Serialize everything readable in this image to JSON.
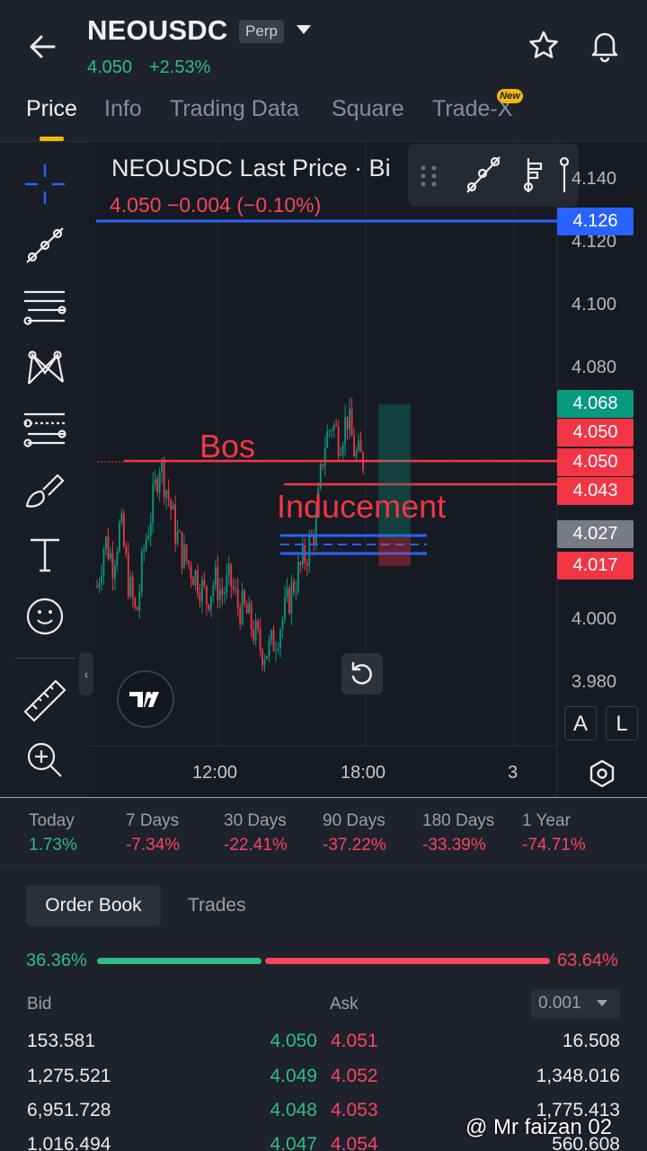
{
  "header": {
    "symbol": "NEOUSDC",
    "contract_type": "Perp",
    "price": "4.050",
    "change": "+2.53%"
  },
  "tabs": [
    {
      "label": "Price",
      "active": true
    },
    {
      "label": "Info"
    },
    {
      "label": "Trading Data"
    },
    {
      "label": "Square"
    },
    {
      "label": "Trade-X",
      "badge": "New"
    }
  ],
  "chart": {
    "title": "NEOUSDC Last Price · Bi",
    "subtitle": "4.050  −0.004 (−0.10%)",
    "y_axis_ticks": [
      "4.140",
      "4.120",
      "4.100",
      "4.080",
      "4.000",
      "3.980"
    ],
    "x_axis_ticks": [
      "12:00",
      "18:00",
      "3"
    ],
    "price_tags": [
      {
        "value": "4.126",
        "color": "#2962ff"
      },
      {
        "value": "4.068",
        "color": "#089981"
      },
      {
        "value": "4.050",
        "color": "#f23645"
      },
      {
        "value": "4.050",
        "color": "#f23645"
      },
      {
        "value": "4.043",
        "color": "#f23645"
      },
      {
        "value": "4.027",
        "color": "#787b86"
      },
      {
        "value": "4.017",
        "color": "#f23645"
      }
    ],
    "annotations": [
      "Bos",
      "Inducement"
    ],
    "scale_buttons": [
      "A",
      "L"
    ]
  },
  "chart_data": {
    "type": "candlestick",
    "title": "NEOUSDC Last Price · Bi",
    "x_ticks": [
      "12:00",
      "18:00",
      "3"
    ],
    "y_ticks": [
      4.14,
      4.12,
      4.1,
      4.08,
      4.0,
      3.98
    ],
    "ylim": [
      3.97,
      4.145
    ],
    "close_path": [
      4.01,
      4.025,
      4.018,
      4.03,
      4.012,
      4.0,
      4.022,
      4.035,
      4.05,
      4.04,
      4.028,
      4.02,
      4.016,
      4.012,
      4.006,
      4.012,
      4.008,
      4.012,
      4.004,
      4.002,
      3.996,
      3.99,
      3.99,
      3.995,
      4.002,
      4.01,
      4.016,
      4.022,
      4.03,
      4.055,
      4.062,
      4.057,
      4.064,
      4.052,
      4.05
    ],
    "horizontal_lines": [
      4.126,
      4.05,
      4.043,
      4.027,
      4.025,
      4.022
    ]
  },
  "performance": [
    {
      "label": "Today",
      "value": "1.73%",
      "positive": true
    },
    {
      "label": "7 Days",
      "value": "-7.34%",
      "positive": false
    },
    {
      "label": "30 Days",
      "value": "-22.41%",
      "positive": false
    },
    {
      "label": "90 Days",
      "value": "-37.22%",
      "positive": false
    },
    {
      "label": "180 Days",
      "value": "-33.39%",
      "positive": false
    },
    {
      "label": "1 Year",
      "value": "-74.71%",
      "positive": false
    }
  ],
  "orderbook": {
    "tab_orderbook": "Order Book",
    "tab_trades": "Trades",
    "bid_pct": "36.36%",
    "ask_pct": "63.64%",
    "bid_ratio": 0.3636,
    "bid_header": "Bid",
    "ask_header": "Ask",
    "precision": "0.001",
    "rows": [
      {
        "bid_qty": "153.581",
        "bid_px": "4.050",
        "ask_px": "4.051",
        "ask_qty": "16.508"
      },
      {
        "bid_qty": "1,275.521",
        "bid_px": "4.049",
        "ask_px": "4.052",
        "ask_qty": "1,348.016"
      },
      {
        "bid_qty": "6,951.728",
        "bid_px": "4.048",
        "ask_px": "4.053",
        "ask_qty": "1,775.413"
      },
      {
        "bid_qty": "1,016.494",
        "bid_px": "4.047",
        "ask_px": "4.054",
        "ask_qty": "560.608"
      }
    ]
  },
  "watermark": "@ Mr faizan 02"
}
